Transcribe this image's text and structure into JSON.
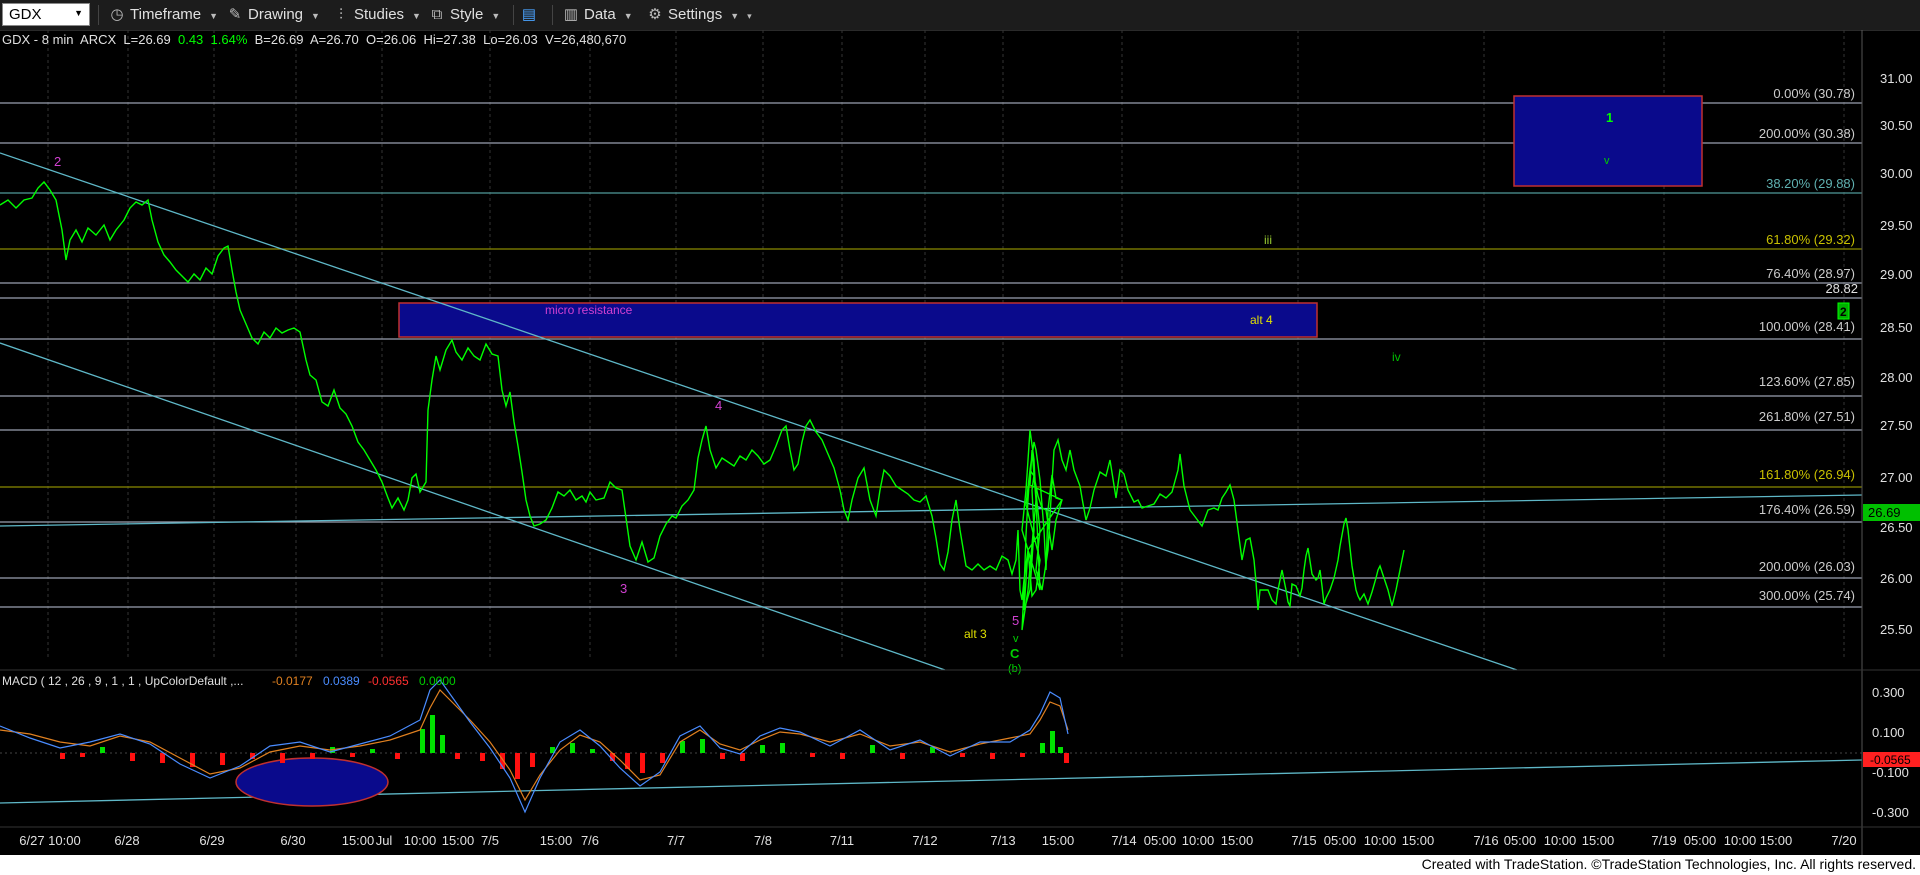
{
  "toolbar": {
    "symbol": "GDX",
    "timeframe": "Timeframe",
    "drawing": "Drawing",
    "studies": "Studies",
    "style": "Style",
    "data": "Data",
    "settings": "Settings"
  },
  "header": {
    "symbol": "GDX - 8 min",
    "exchange": "ARCX",
    "last": "L=26.69",
    "change": "0.43",
    "change_pct": "1.64%",
    "bid": "B=26.69",
    "ask": "A=26.70",
    "open": "O=26.06",
    "high": "Hi=27.38",
    "low": "Lo=26.03",
    "volume": "V=26,480,670"
  },
  "price_axis": {
    "ticks": [
      "31.00",
      "30.50",
      "30.00",
      "29.50",
      "29.00",
      "28.50",
      "28.00",
      "27.50",
      "27.00",
      "26.50",
      "26.00",
      "25.50"
    ],
    "marker_value": "28.82",
    "last_price": "26.69",
    "up_color": "#00ff00"
  },
  "fib_labels": [
    {
      "text": "0.00% (30.78)",
      "color": "#cccccc"
    },
    {
      "text": "200.00% (30.38)",
      "color": "#cccccc"
    },
    {
      "text": "38.20% (29.88)",
      "color": "#5fb0b0"
    },
    {
      "text": "61.80% (29.32)",
      "color": "#c8c000"
    },
    {
      "text": "76.40% (28.97)",
      "color": "#cccccc"
    },
    {
      "text": "100.00% (28.41)",
      "color": "#cccccc"
    },
    {
      "text": "123.60% (27.85)",
      "color": "#cccccc"
    },
    {
      "text": "261.80% (27.51)",
      "color": "#cccccc"
    },
    {
      "text": "161.80% (26.94)",
      "color": "#c8c000"
    },
    {
      "text": "176.40% (26.59)",
      "color": "#cccccc"
    },
    {
      "text": "200.00% (26.03)",
      "color": "#cccccc"
    },
    {
      "text": "300.00% (25.74)",
      "color": "#cccccc"
    }
  ],
  "annotations": {
    "micro_resistance": "micro resistance",
    "alt4": "alt 4",
    "alt3": "alt 3",
    "wave2_magenta": "2",
    "wave3_magenta": "3",
    "wave4_magenta": "4",
    "wave5_magenta": "5",
    "wave_v_green": "v",
    "wave_c_green": "C",
    "wave_b_green": "(b)",
    "wave_iii": "iii",
    "wave_iv": "iv",
    "wave1_box": "1",
    "wave_v_box": "v",
    "wave2_boxed": "2"
  },
  "macd": {
    "label": "MACD ( 12 , 26 , 9 , 1 , 1 , UpColorDefault ,...",
    "v1": "-0.0177",
    "v2": "0.0389",
    "v3": "-0.0565",
    "v4": "0.0000",
    "ticks": [
      "0.300",
      "0.100",
      "-0.100",
      "-0.300"
    ],
    "marker": "-0.0565"
  },
  "time_axis": [
    "6/27 10:00",
    "6/28",
    "6/29",
    "6/30",
    "15:00",
    "Jul",
    "10:00",
    "15:00",
    "7/5",
    "15:00",
    "7/6",
    "7/7",
    "7/8",
    "7/11",
    "7/12",
    "7/13",
    "15:00",
    "7/14",
    "05:00",
    "10:00",
    "15:00",
    "7/15",
    "05:00",
    "10:00",
    "15:00",
    "7/16",
    "05:00",
    "10:00",
    "15:00",
    "7/19",
    "05:00",
    "10:00",
    "15:00",
    "7/20"
  ],
  "footer": "Created with TradeStation. ©TradeStation Technologies, Inc. All rights reserved."
}
